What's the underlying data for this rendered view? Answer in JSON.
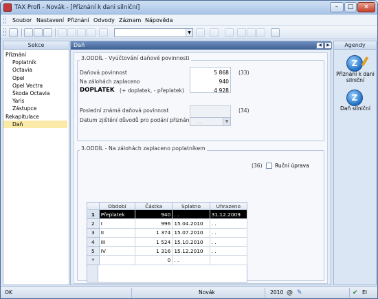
{
  "window": {
    "title": "TAX Profi - Novák - [Přiznání k dani silniční]"
  },
  "menu": [
    "Soubor",
    "Nastavení",
    "Přiznání",
    "Odvody",
    "Záznam",
    "Nápověda"
  ],
  "sidebar": {
    "header": "Sekce",
    "items": [
      {
        "label": "Přiznání",
        "level": 0
      },
      {
        "label": "Poplatník",
        "level": 1
      },
      {
        "label": "Octavia",
        "level": 1
      },
      {
        "label": "Opel",
        "level": 1
      },
      {
        "label": "Opel Vectra",
        "level": 1
      },
      {
        "label": "Škoda Octavia",
        "level": 1
      },
      {
        "label": "Yaris",
        "level": 1
      },
      {
        "label": "Zástupce",
        "level": 1
      },
      {
        "label": "Rekapitulace",
        "level": 0
      },
      {
        "label": "Daň",
        "level": 1,
        "selected": true
      }
    ]
  },
  "main": {
    "header": "Daň",
    "section3": {
      "title": "3.ODDÍL - Vyúčtování daňové povinnosti",
      "rows": [
        {
          "label": "Daňová povinnost",
          "value": "5 868"
        },
        {
          "label": "Na zálohách zaplaceno",
          "value": "940"
        }
      ],
      "result_label": "DOPLATEK",
      "result_hint": "(+ doplatek, - přeplatek)",
      "result_value": "4 928",
      "ref33": "(33)",
      "ref34": "(34)",
      "last_known_label": "Poslední známá daňová povinnost",
      "date_label": "Datum zjištění důvodů pro podání přiznání",
      "date_value": ". ."
    },
    "section_payments": {
      "title": "3.ODDÍL - Na zálohách zaplaceno poplatníkem",
      "ref36": "(36)",
      "manual_label": "Ruční úprava",
      "columns": [
        "Období",
        "Částka",
        "Splatno",
        "Uhrazeno"
      ],
      "rows": [
        {
          "num": "1",
          "period": "Přeplatek",
          "amount": "940",
          "due": ". .",
          "paid": "31.12.2009"
        },
        {
          "num": "2",
          "period": "I",
          "amount": "996",
          "due": "15.04.2010",
          "paid": ". ."
        },
        {
          "num": "3",
          "period": "II",
          "amount": "1 374",
          "due": "15.07.2010",
          "paid": ". ."
        },
        {
          "num": "4",
          "period": "III",
          "amount": "1 524",
          "due": "15.10.2010",
          "paid": ". ."
        },
        {
          "num": "5",
          "period": "IV",
          "amount": "1 316",
          "due": "15.12.2010",
          "paid": ". ."
        },
        {
          "num": "*",
          "period": "",
          "amount": "0",
          "due": ". .",
          "paid": ""
        }
      ]
    }
  },
  "agenda": {
    "header": "Agendy",
    "items": [
      {
        "label": "Přiznání k dani silniční",
        "icon": "tax-return-icon"
      },
      {
        "label": "Daň silniční",
        "icon": "road-tax-icon"
      }
    ]
  },
  "status": {
    "left": "OK",
    "user": "Novák",
    "year": "2010",
    "lang": "EI"
  }
}
